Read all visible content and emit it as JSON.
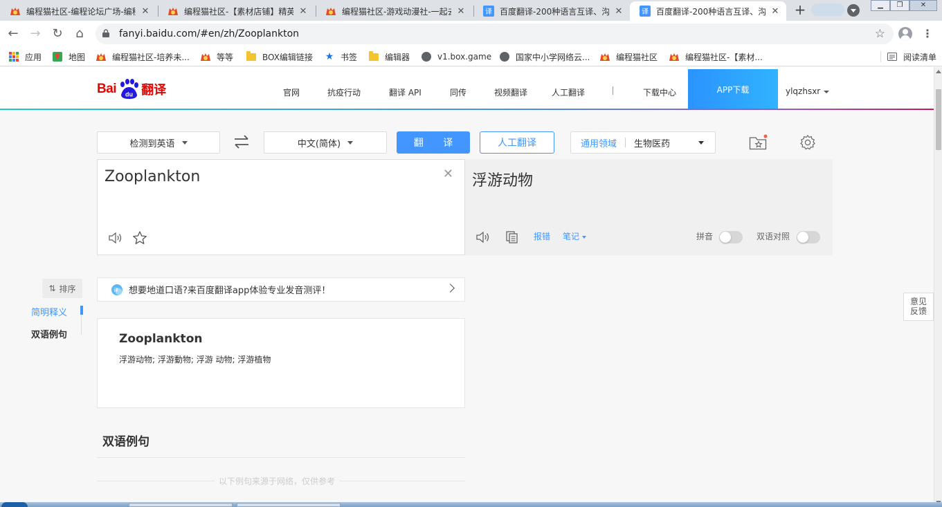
{
  "browser": {
    "tabs": [
      {
        "title": "编程猫社区-编程论坛广场-编程",
        "active": false
      },
      {
        "title": "编程猫社区-【素材店铺】精英",
        "active": false
      },
      {
        "title": "编程猫社区-游戏动漫社-一起去",
        "active": false
      },
      {
        "title": "百度翻译-200种语言互译、沟",
        "active": false
      },
      {
        "title": "百度翻译-200种语言互译、沟",
        "active": true
      }
    ],
    "url": "fanyi.baidu.com/#en/zh/Zooplankton",
    "bookmarks": [
      {
        "label": "应用",
        "icon": "apps-icon"
      },
      {
        "label": "地图",
        "icon": "maps-icon"
      },
      {
        "label": "编程猫社区-培养未...",
        "icon": "codemao-icon"
      },
      {
        "label": "等等",
        "icon": "codemao-icon"
      },
      {
        "label": "BOX编辑链接",
        "icon": "folder-icon"
      },
      {
        "label": "书签",
        "icon": "star-icon"
      },
      {
        "label": "编辑器",
        "icon": "folder-icon"
      },
      {
        "label": "v1.box.game",
        "icon": "globe-icon"
      },
      {
        "label": "国家中小学网络云...",
        "icon": "globe-icon"
      },
      {
        "label": "编程猫社区",
        "icon": "codemao-icon"
      },
      {
        "label": "编程猫社区-【素材...",
        "icon": "codemao-icon"
      }
    ],
    "reading_list": "阅读清单"
  },
  "site": {
    "logo": {
      "bai": "Bai",
      "du": "du",
      "fanyi": "翻译"
    },
    "nav": [
      "官网",
      "抗疫行动",
      "翻译 API",
      "同传",
      "视频翻译",
      "人工翻译",
      "下载中心"
    ],
    "app_download": "APP下载",
    "username": "ylqzhsxr"
  },
  "controls": {
    "source_lang": "检测到英语",
    "target_lang": "中文(简体)",
    "translate_button": "翻 译",
    "human_button": "人工翻译",
    "domain_label": "通用领域",
    "domain_value": "生物医药"
  },
  "source": {
    "text": "Zooplankton"
  },
  "target": {
    "text": "浮游动物",
    "report": "报错",
    "notes": "笔记",
    "pinyin": "拼音",
    "bilingual": "双语对照"
  },
  "sidebar": {
    "sort": "排序",
    "items": [
      "简明释义",
      "双语例句"
    ]
  },
  "promo": {
    "text": "想要地道口语?来百度翻译app体验专业发音测评！"
  },
  "result": {
    "word": "Zooplankton",
    "meanings": "浮游动物;  浮游動物;  浮游 动物;  浮游植物"
  },
  "examples": {
    "title": "双语例句",
    "note": "以下例句来源于网络，仅供参考"
  },
  "feedback": {
    "line1": "意见",
    "line2": "反馈"
  },
  "colors": {
    "accent": "#4395ff",
    "brand_red": "#e10601"
  }
}
